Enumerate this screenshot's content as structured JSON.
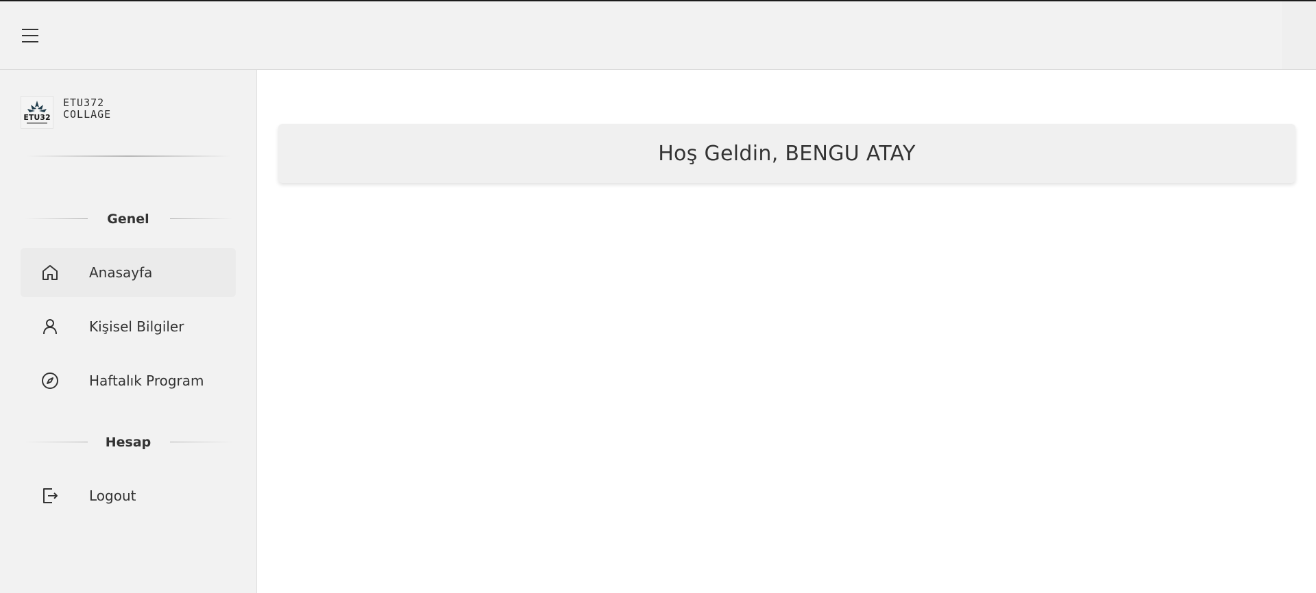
{
  "topbar": {
    "menu_icon": "hamburger-menu-icon"
  },
  "brand": {
    "line1": "ETU372",
    "line2": "COLLAGE",
    "logo_mark": "ETU32"
  },
  "sidebar": {
    "sections": [
      {
        "title": "Genel"
      },
      {
        "title": "Hesap"
      }
    ],
    "items": [
      {
        "label": "Anasayfa",
        "icon": "home-icon",
        "active": true
      },
      {
        "label": "Kişisel Bilgiler",
        "icon": "user-icon",
        "active": false
      },
      {
        "label": "Haftalık Program",
        "icon": "compass-icon",
        "active": false
      },
      {
        "label": "Logout",
        "icon": "logout-icon",
        "active": false
      }
    ]
  },
  "main": {
    "welcome": "Hoş Geldin, BENGU ATAY"
  },
  "colors": {
    "topbar_bg": "#f2f2f2",
    "sidebar_bg": "#f2f2f2",
    "active_item_bg": "#ebebeb",
    "card_bg": "#f0f0f0"
  }
}
